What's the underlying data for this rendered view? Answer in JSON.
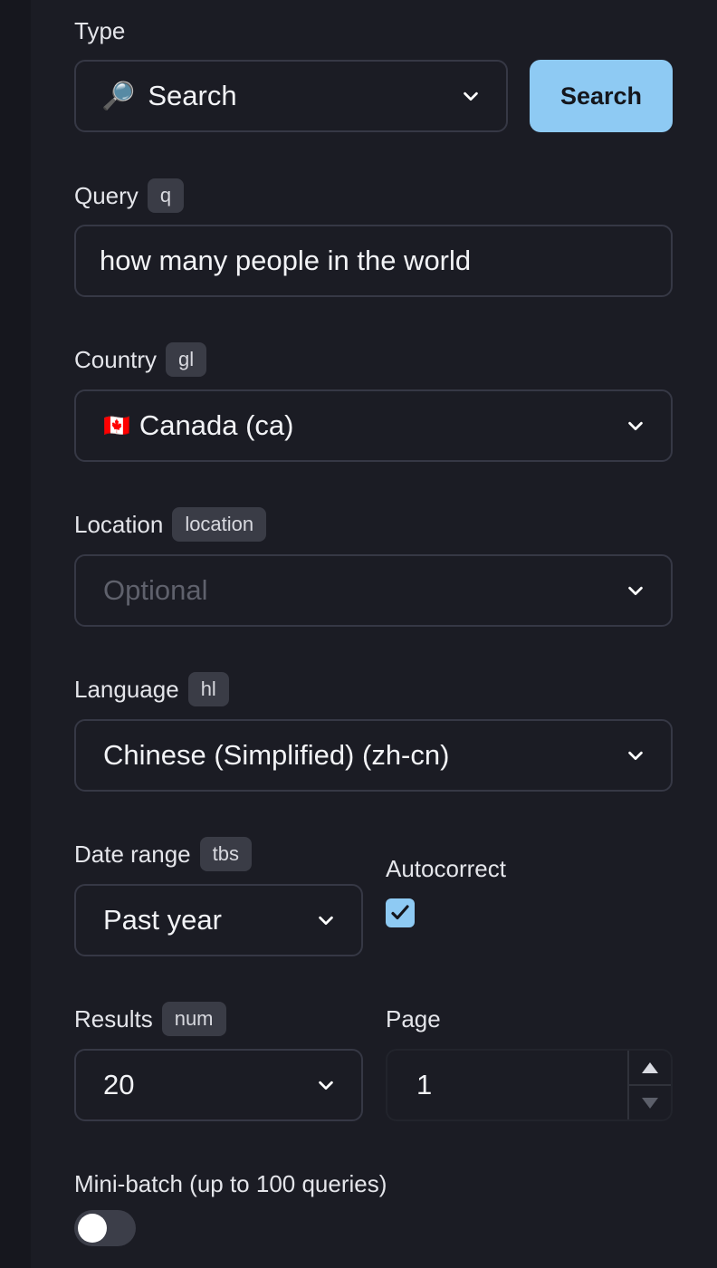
{
  "type": {
    "label": "Type",
    "icon": "magnifier-emoji-icon",
    "icon_glyph": "🔎",
    "value": "Search"
  },
  "search_button": {
    "label": "Search"
  },
  "query": {
    "label": "Query",
    "badge": "q",
    "value": "how many people in the world"
  },
  "country": {
    "label": "Country",
    "badge": "gl",
    "flag": "🇨🇦",
    "value": "Canada (ca)"
  },
  "location": {
    "label": "Location",
    "badge": "location",
    "placeholder": "Optional"
  },
  "language": {
    "label": "Language",
    "badge": "hl",
    "value": "Chinese (Simplified) (zh-cn)"
  },
  "date_range": {
    "label": "Date range",
    "badge": "tbs",
    "value": "Past year"
  },
  "autocorrect": {
    "label": "Autocorrect",
    "checked": true
  },
  "results": {
    "label": "Results",
    "badge": "num",
    "value": "20"
  },
  "page": {
    "label": "Page",
    "value": "1"
  },
  "mini_batch": {
    "label": "Mini-batch (up to 100 queries)",
    "enabled": false
  },
  "colors": {
    "background": "#1b1c24",
    "accent": "#8ecaf3",
    "border": "#363845",
    "badge": "#3a3c46"
  }
}
